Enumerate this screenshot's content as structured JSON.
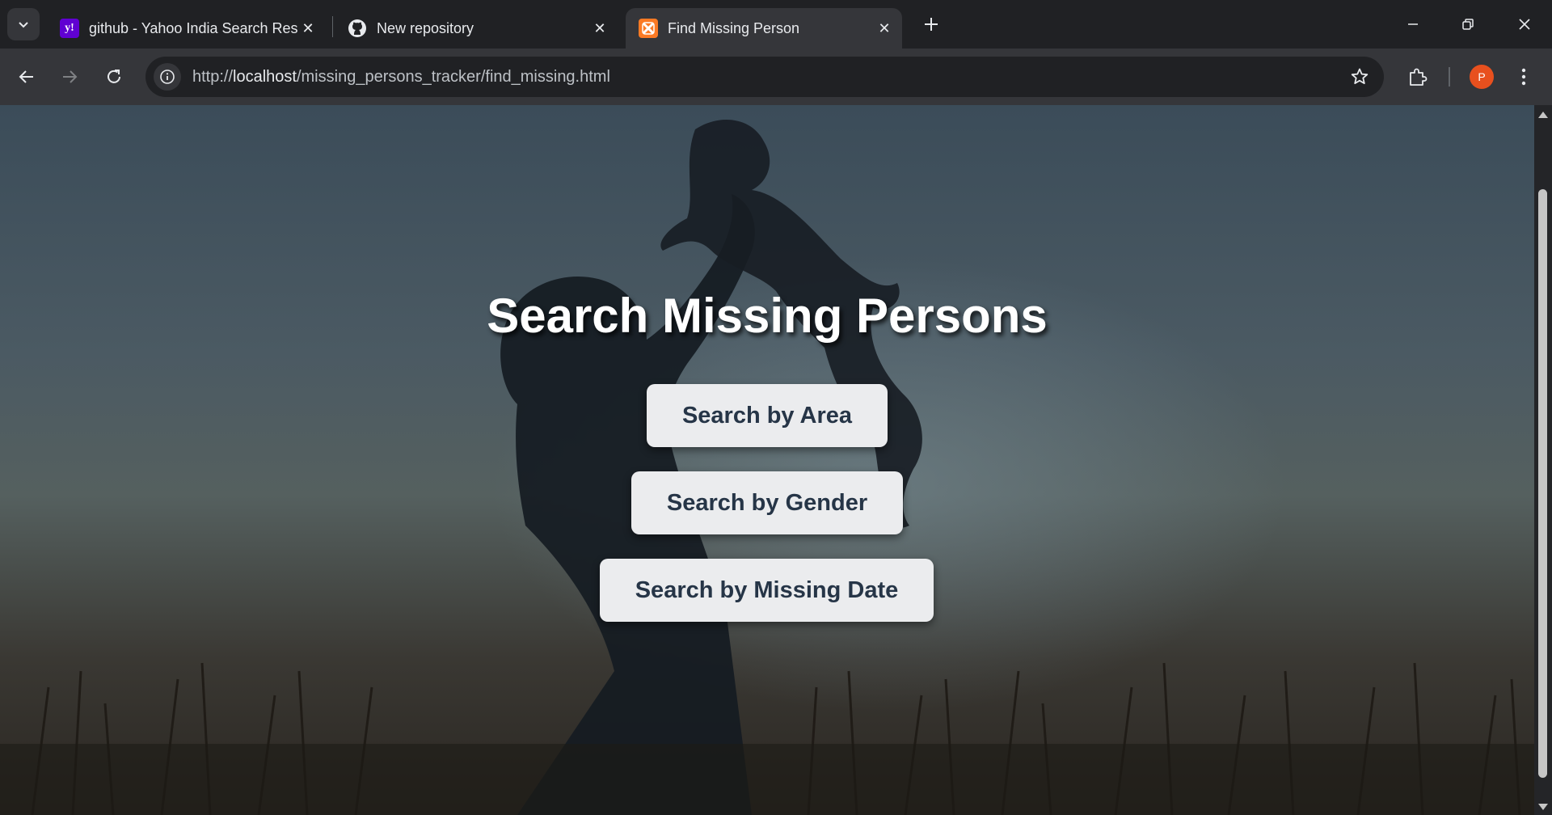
{
  "tabs": [
    {
      "title": "github - Yahoo India Search Res",
      "favicon": "yahoo-icon",
      "color": "#6001d2"
    },
    {
      "title": "New repository",
      "favicon": "github-icon"
    },
    {
      "title": "Find Missing Person",
      "favicon": "xampp-icon",
      "color": "#fb7a24",
      "active": true
    }
  ],
  "toolbar": {
    "url_prefix": "http://",
    "url_host": "localhost",
    "url_path": "/missing_persons_tracker/find_missing.html",
    "profile_initial": "P",
    "profile_color": "#e8501e"
  },
  "page": {
    "title": "Search Missing Persons",
    "buttons": {
      "area": "Search by Area",
      "gender": "Search by Gender",
      "missing_date": "Search by Missing Date"
    }
  }
}
